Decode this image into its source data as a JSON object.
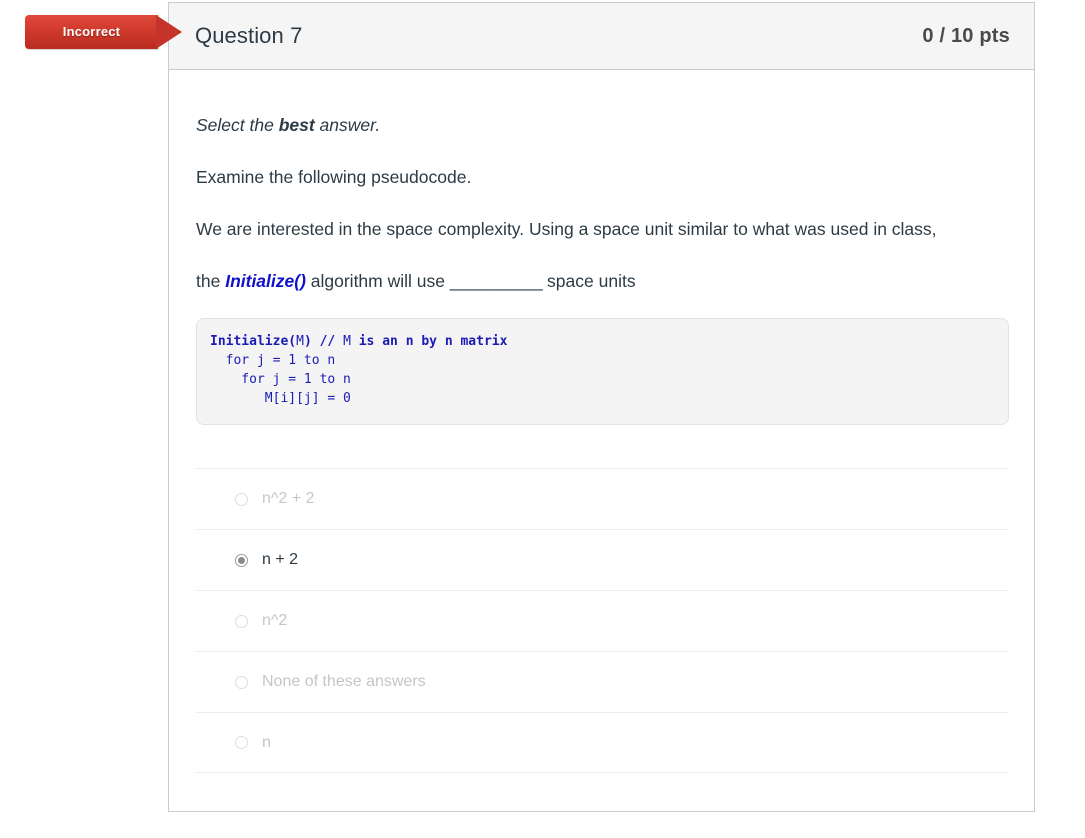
{
  "flag": {
    "label": "Incorrect",
    "color": "#c5342a"
  },
  "header": {
    "question_name": "Question 7",
    "points": "0 / 10 pts"
  },
  "body": {
    "instruction_prefix": "Select the ",
    "instruction_emphasis": "best",
    "instruction_suffix": " answer.",
    "line2": "Examine the following pseudocode.",
    "line3": "We are interested in the space complexity. Using a space unit similar to what was used in class,",
    "line4_prefix": "the ",
    "line4_keyword": "Initialize()",
    "line4_mid": " algorithm will use ",
    "line4_blank": "__________",
    "line4_suffix": " space units"
  },
  "code": {
    "line1_a": "Initialize",
    "line1_b": "(",
    "line1_c": "M",
    "line1_d": ") ",
    "line1_e": "// ",
    "line1_f": "M ",
    "line1_g": "is an n by n matrix",
    "line2": "  for j = 1 to n",
    "line3": "    for j = 1 to n",
    "line4": "       M[i][j] = 0"
  },
  "answers": [
    {
      "label": "n^2 + 2",
      "selected": false
    },
    {
      "label": "n + 2",
      "selected": true
    },
    {
      "label": "n^2",
      "selected": false
    },
    {
      "label": "None of these answers",
      "selected": false
    },
    {
      "label": "n",
      "selected": false
    }
  ]
}
